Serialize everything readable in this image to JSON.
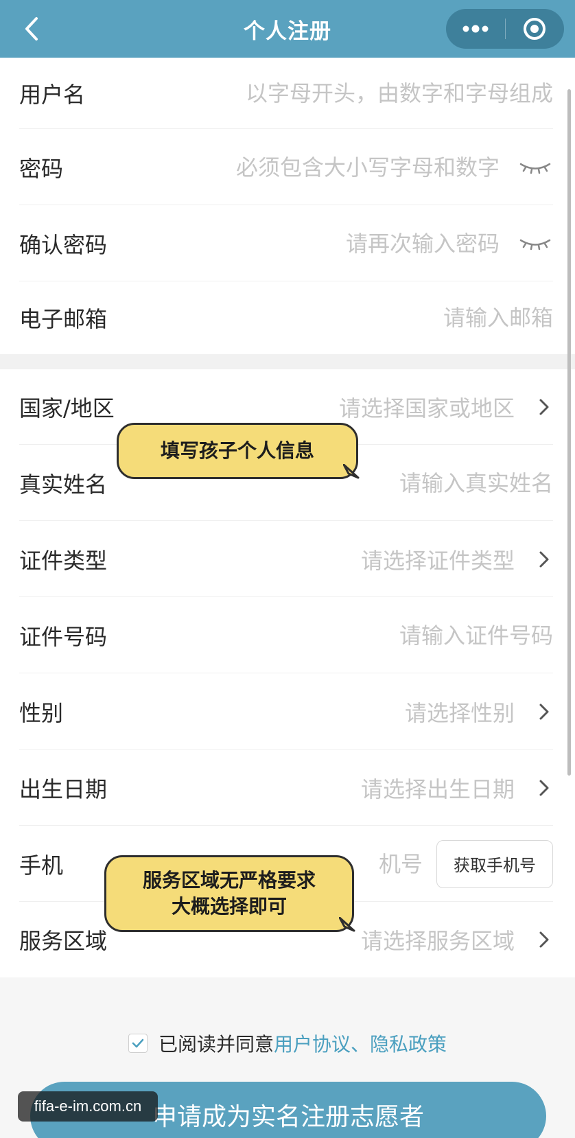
{
  "header": {
    "title": "个人注册",
    "back_icon": "chevron-left-icon",
    "menu_icon": "more-dots-icon",
    "close_icon": "target-circle-icon"
  },
  "colors": {
    "primary": "#5aa2bf",
    "link": "#4a9fbf",
    "bubble": "#f5dc79",
    "placeholder": "#c5c5c5"
  },
  "form": {
    "username": {
      "label": "用户名",
      "placeholder": "以字母开头，由数字和字母组成"
    },
    "password": {
      "label": "密码",
      "placeholder": "必须包含大小写字母和数字"
    },
    "confirm_password": {
      "label": "确认密码",
      "placeholder": "请再次输入密码"
    },
    "email": {
      "label": "电子邮箱",
      "placeholder": "请输入邮箱"
    },
    "country": {
      "label": "国家/地区",
      "placeholder": "请选择国家或地区"
    },
    "real_name": {
      "label": "真实姓名",
      "placeholder": "请输入真实姓名"
    },
    "id_type": {
      "label": "证件类型",
      "placeholder": "请选择证件类型"
    },
    "id_number": {
      "label": "证件号码",
      "placeholder": "请输入证件号码"
    },
    "gender": {
      "label": "性别",
      "placeholder": "请选择性别"
    },
    "birth_date": {
      "label": "出生日期",
      "placeholder": "请选择出生日期"
    },
    "phone": {
      "label": "手机",
      "placeholder": "机号",
      "button": "获取手机号"
    },
    "service_area": {
      "label": "服务区域",
      "placeholder": "请选择服务区域"
    }
  },
  "agreement": {
    "prefix": "已阅读并同意",
    "user_agreement": "用户协议",
    "separator": "、",
    "privacy_policy": "隐私政策"
  },
  "submit": {
    "label": "申请成为实名注册志愿者"
  },
  "watermark": {
    "text": "fifa-e-im.com.cn"
  },
  "annotations": {
    "bubble1": "填写孩子个人信息",
    "bubble2_line1": "服务区域无严格要求",
    "bubble2_line2": "大概选择即可"
  }
}
